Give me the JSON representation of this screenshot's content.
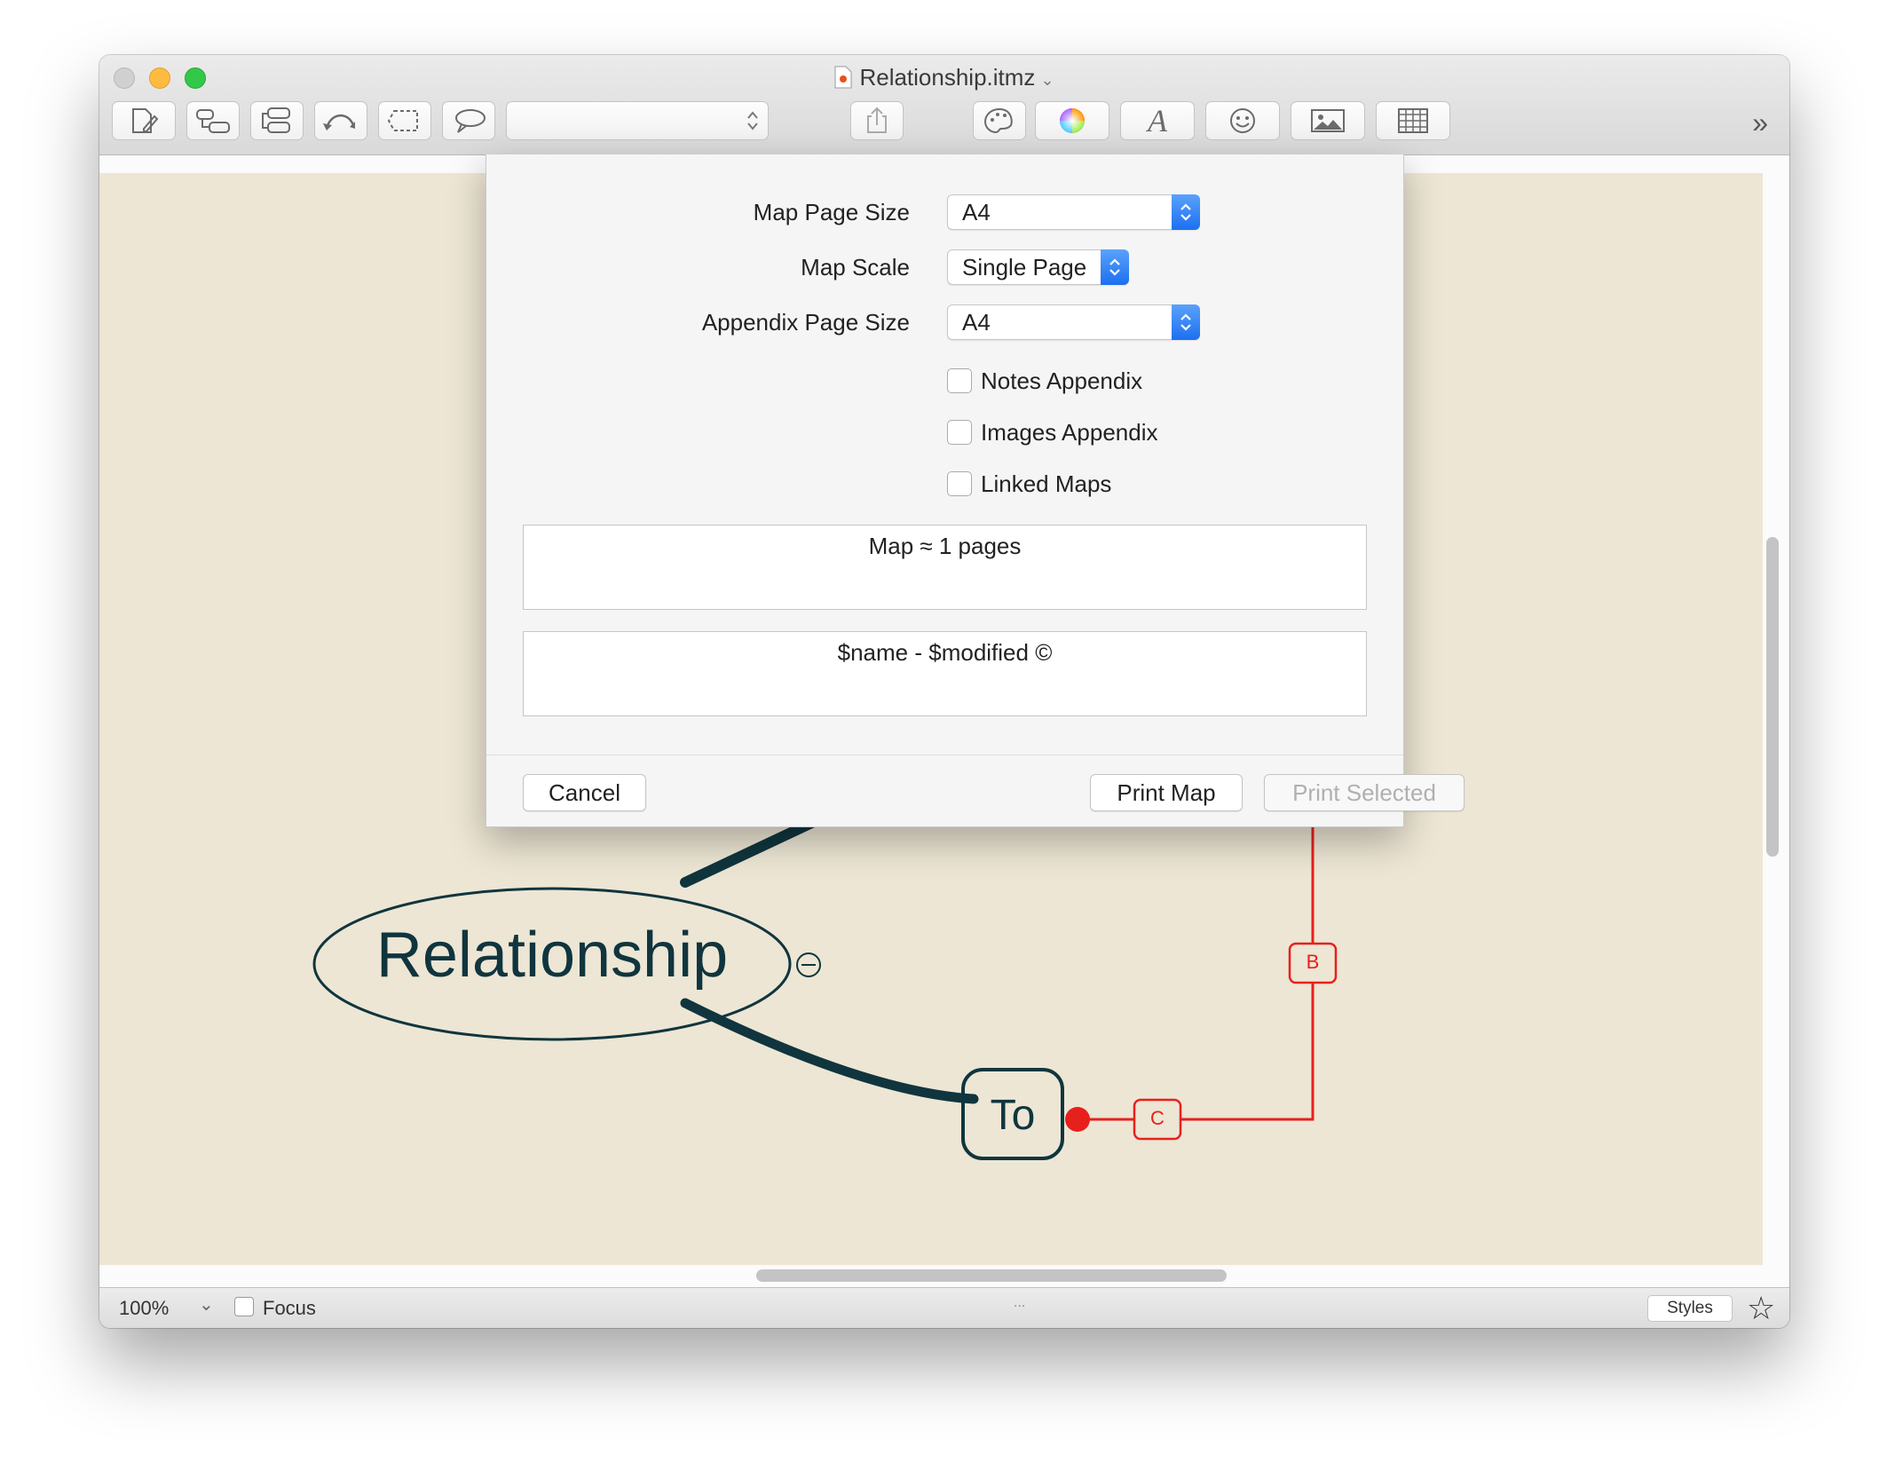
{
  "window": {
    "title": "Relationship.itmz"
  },
  "toolbar": {
    "icons": [
      "new-topic-icon",
      "child-topic-icon",
      "sibling-topic-icon",
      "relationship-icon",
      "boundary-icon",
      "callout-icon",
      "share-icon",
      "palette-icon",
      "color-wheel-icon",
      "font-icon",
      "emoji-icon",
      "image-icon",
      "table-icon"
    ],
    "overflow": "»"
  },
  "dialog": {
    "map_page_size": {
      "label": "Map Page Size",
      "value": "A4"
    },
    "map_scale": {
      "label": "Map Scale",
      "value": "Single Page"
    },
    "appendix_page_size": {
      "label": "Appendix Page Size",
      "value": "A4"
    },
    "notes_appendix": {
      "label": "Notes Appendix",
      "checked": false
    },
    "images_appendix": {
      "label": "Images Appendix",
      "checked": false
    },
    "linked_maps": {
      "label": "Linked Maps",
      "checked": false
    },
    "summary": "Map ≈ 1 pages",
    "footer_text": "$name - $modified ©",
    "cancel": "Cancel",
    "print_map": "Print Map",
    "print_selected": "Print Selected"
  },
  "map": {
    "central_topic": "Relationship",
    "to_topic": "To",
    "relation_label_b": "B",
    "relation_label_c": "C",
    "colors": {
      "canvas": "#ede6d4",
      "topic": "#10353e",
      "relationship": "#e8201b"
    }
  },
  "statusbar": {
    "zoom": "100%",
    "focus_label": "Focus",
    "focus_checked": false,
    "dots": "...",
    "styles": "Styles"
  }
}
